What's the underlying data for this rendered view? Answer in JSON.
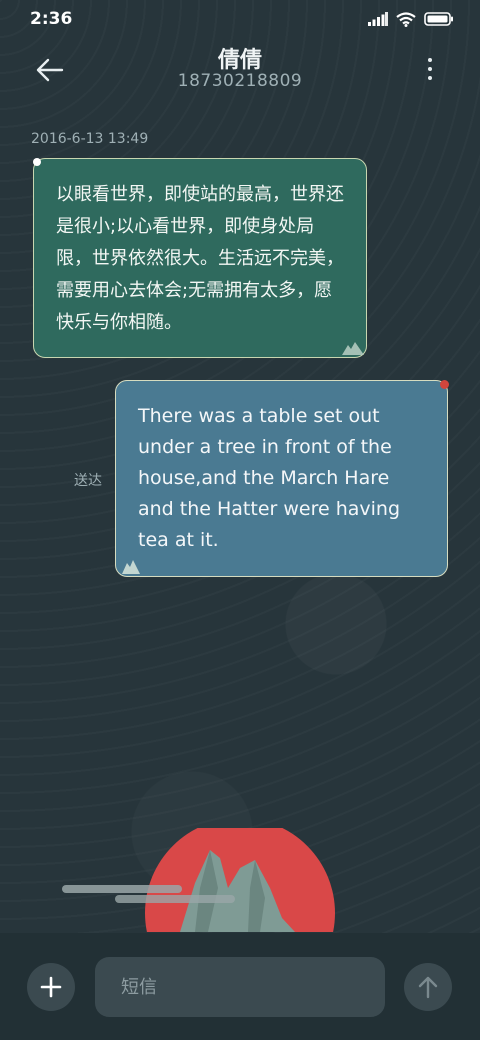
{
  "status_bar": {
    "time": "2:36",
    "icons": [
      "signal-icon",
      "wifi-icon",
      "battery-icon"
    ]
  },
  "header": {
    "title": "倩倩",
    "subtitle": "18730218809",
    "back_icon": "arrow-left-icon",
    "more_icon": "more-vertical-icon"
  },
  "conversation": {
    "timestamp": "2016-6-13 13:49",
    "incoming_message": "以眼看世界，即使站的最高，世界还是很小;以心看世界，即使身处局限，世界依然很大。生活远不完美，需要用心去体会;无需拥有太多，愿快乐与你相随。",
    "outgoing_message": "There was a table set out under a tree in front of the house,and the March Hare and the Hatter were having tea at it.",
    "outgoing_status": "送达"
  },
  "input_bar": {
    "placeholder": "短信",
    "add_icon": "plus-icon",
    "send_icon": "arrow-up-icon"
  },
  "colors": {
    "background": "#27353b",
    "incoming_bubble": "#2f6a5e",
    "outgoing_bubble": "#4a7a92",
    "sun": "#d94848"
  }
}
